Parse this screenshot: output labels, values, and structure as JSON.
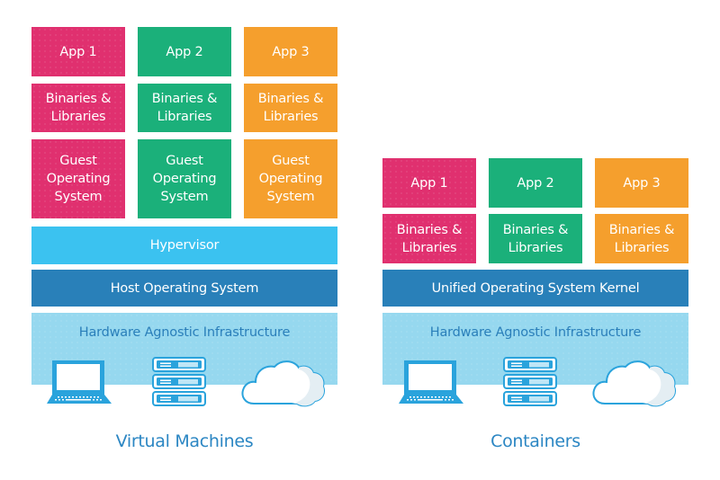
{
  "colors": {
    "app1": "#e0306f",
    "app2": "#1bb07a",
    "app3": "#f59f2d",
    "hypervisor": "#3bc2f0",
    "os": "#2980b9",
    "hardware": "#96d8ef",
    "label_blue": "#2b86c3"
  },
  "virtual_machines": {
    "title": "Virtual Machines",
    "columns": [
      {
        "app": "App 1",
        "bins": "Binaries &\nLibraries",
        "guest_os": "Guest\nOperating\nSystem"
      },
      {
        "app": "App 2",
        "bins": "Binaries &\nLibraries",
        "guest_os": "Guest\nOperating\nSystem"
      },
      {
        "app": "App 3",
        "bins": "Binaries &\nLibraries",
        "guest_os": "Guest\nOperating\nSystem"
      }
    ],
    "hypervisor": "Hypervisor",
    "host_os": "Host Operating System",
    "hardware": "Hardware Agnostic Infrastructure",
    "icons": [
      "laptop-icon",
      "server-rack-icon",
      "cloud-icon"
    ]
  },
  "containers": {
    "title": "Containers",
    "columns": [
      {
        "app": "App 1",
        "bins": "Binaries &\nLibraries"
      },
      {
        "app": "App 2",
        "bins": "Binaries &\nLibraries"
      },
      {
        "app": "App 3",
        "bins": "Binaries &\nLibraries"
      }
    ],
    "kernel": "Unified Operating System Kernel",
    "hardware": "Hardware Agnostic Infrastructure",
    "icons": [
      "laptop-icon",
      "server-rack-icon",
      "cloud-icon"
    ]
  }
}
